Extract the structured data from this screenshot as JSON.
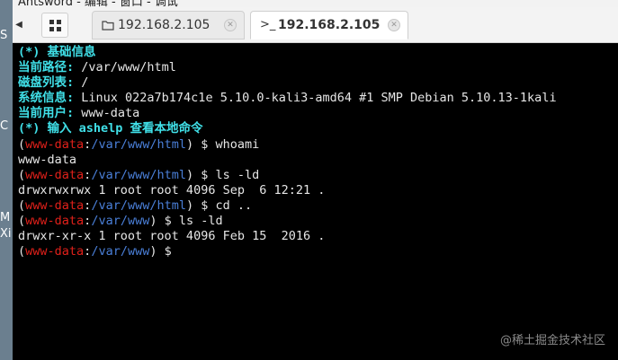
{
  "window": {
    "title_fragment": "Antsword - 编辑 - 窗口 - 调试"
  },
  "desktop_labels": [
    "S",
    "C",
    "M",
    "Xi"
  ],
  "tabs": [
    {
      "icon": "folder-icon",
      "label": "192.168.2.105",
      "active": false
    },
    {
      "icon": "terminal-icon",
      "label": "192.168.2.105",
      "active": true
    }
  ],
  "terminal": {
    "info": {
      "header": "(*) 基础信息",
      "path_label": "当前路径:",
      "path_value": " /var/www/html",
      "disk_label": "磁盘列表:",
      "disk_value": " /",
      "sys_label": "系统信息:",
      "sys_value": " Linux 022a7b174c1e 5.10.0-kali3-amd64 #1 SMP Debian 5.10.13-1kali",
      "user_label": "当前用户:",
      "user_value": " www-data",
      "help": "(*) 输入 ashelp 查看本地命令"
    },
    "session": [
      {
        "user": "www-data",
        "dir": "/var/www/html",
        "cmd": "whoami"
      },
      {
        "output": "www-data"
      },
      {
        "user": "www-data",
        "dir": "/var/www/html",
        "cmd": "ls -ld"
      },
      {
        "output": "drwxrwxrwx 1 root root 4096 Sep  6 12:21 ."
      },
      {
        "user": "www-data",
        "dir": "/var/www/html",
        "cmd": "cd .."
      },
      {
        "user": "www-data",
        "dir": "/var/www",
        "cmd": "ls -ld"
      },
      {
        "output": "drwxr-xr-x 1 root root 4096 Feb 15  2016 ."
      },
      {
        "user": "www-data",
        "dir": "/var/www",
        "cmd": ""
      }
    ]
  },
  "watermark": "@稀土掘金技术社区",
  "colors": {
    "accent_cyan": "#40e0e8",
    "prompt_user": "#e0201a",
    "prompt_dir": "#4a7fd8",
    "terminal_bg": "#000000"
  }
}
